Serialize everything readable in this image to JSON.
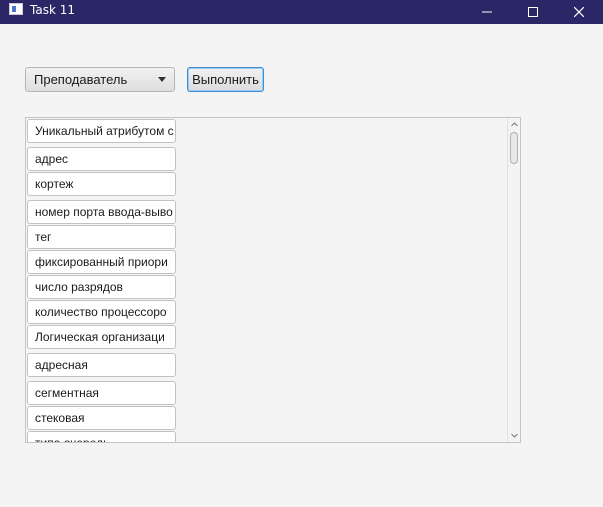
{
  "window": {
    "title": "Task 11",
    "icons": {
      "app": "app-icon",
      "minimize": "minimize-icon",
      "maximize": "maximize-icon",
      "close": "close-icon"
    }
  },
  "toolbar": {
    "combo_value": "Преподаватель",
    "combo_icon": "chevron-down-icon",
    "run_label": "Выполнить"
  },
  "list": {
    "items": [
      "Уникальный атрибутом с",
      "адрес",
      "кортеж",
      "номер порта ввода-выво",
      "тег",
      "фиксированный приори",
      "число разрядов",
      "количество процессоро",
      "Логическая организаци",
      "адресная",
      "сегментная",
      "стековая",
      "типа очередь"
    ],
    "scroll_icons": {
      "up": "scroll-up-icon",
      "down": "scroll-down-icon"
    }
  },
  "colors": {
    "titlebar": "#2b2665",
    "background": "#f4f4f4",
    "button_focus": "#3a8fd6"
  }
}
